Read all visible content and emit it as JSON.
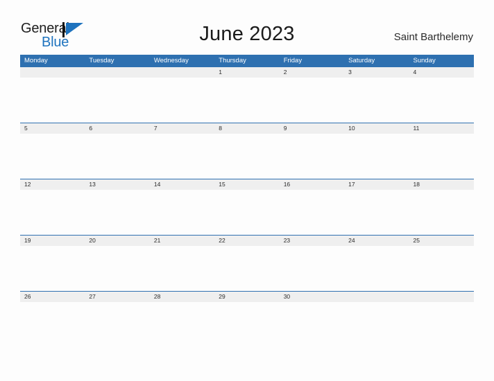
{
  "brand": {
    "word_one": "General",
    "word_two": "Blue",
    "flag_icon": "flag-triangle-icon",
    "black_hex": "#1D1D1D",
    "blue_hex": "#1E73BE"
  },
  "header": {
    "title": "June 2023",
    "subtitle": "Saint Barthelemy"
  },
  "colors": {
    "header_blue": "#2E70B0",
    "band_gray": "#EFEFEF",
    "page_background": "#FDFDFD",
    "text_dark": "#2A2A2A"
  },
  "calendar": {
    "month": "June",
    "year": "2023",
    "weekday_headers": [
      "Monday",
      "Tuesday",
      "Wednesday",
      "Thursday",
      "Friday",
      "Saturday",
      "Sunday"
    ],
    "weeks": [
      [
        "",
        "",
        "",
        "1",
        "2",
        "3",
        "4"
      ],
      [
        "5",
        "6",
        "7",
        "8",
        "9",
        "10",
        "11"
      ],
      [
        "12",
        "13",
        "14",
        "15",
        "16",
        "17",
        "18"
      ],
      [
        "19",
        "20",
        "21",
        "22",
        "23",
        "24",
        "25"
      ],
      [
        "26",
        "27",
        "28",
        "29",
        "30",
        "",
        ""
      ]
    ]
  }
}
